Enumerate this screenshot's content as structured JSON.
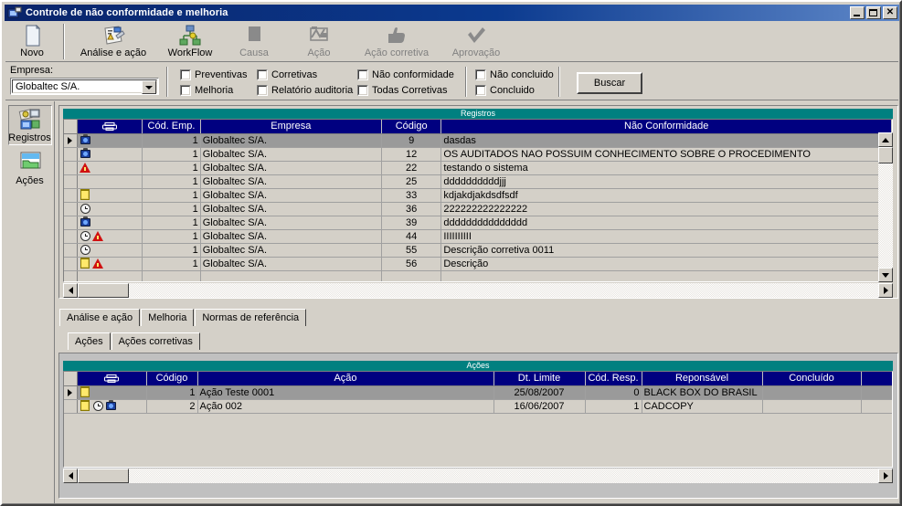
{
  "window": {
    "title": "Controle de não conformidade e melhoria",
    "icon": "app-icon",
    "minimize_label": "_",
    "maximize_label": "□",
    "close_label": "✕"
  },
  "toolbar": {
    "buttons": [
      {
        "label": "Novo",
        "icon": "new-document-icon",
        "enabled": true
      },
      {
        "label": "Análise e ação",
        "icon": "analysis-icon",
        "enabled": true
      },
      {
        "label": "WorkFlow",
        "icon": "workflow-icon",
        "enabled": true
      },
      {
        "label": "Causa",
        "icon": "cause-icon",
        "enabled": false
      },
      {
        "label": "Ação",
        "icon": "action-icon",
        "enabled": false
      },
      {
        "label": "Ação corretiva",
        "icon": "corrective-action-icon",
        "enabled": false
      },
      {
        "label": "Aprovação",
        "icon": "approval-check-icon",
        "enabled": false
      }
    ]
  },
  "filters": {
    "empresa_label": "Empresa:",
    "empresa_value": "Globaltec S/A.",
    "group1": [
      {
        "label": "Preventivas",
        "checked": false
      },
      {
        "label": "Melhoria",
        "checked": false
      }
    ],
    "group2": [
      {
        "label": "Corretivas",
        "checked": false
      },
      {
        "label": "Relatório auditoria",
        "checked": false
      }
    ],
    "group3": [
      {
        "label": "Não conformidade",
        "checked": false
      },
      {
        "label": "Todas Corretivas",
        "checked": false
      }
    ],
    "group4": [
      {
        "label": "Não concluido",
        "checked": false
      },
      {
        "label": "Concluido",
        "checked": false
      }
    ],
    "search_button": "Buscar"
  },
  "sidebar": {
    "items": [
      {
        "label": "Registros",
        "icon": "records-icon",
        "selected": true
      },
      {
        "label": "Ações",
        "icon": "folder-actions-icon",
        "selected": false
      }
    ]
  },
  "registros_grid": {
    "caption": "Registros",
    "columns": [
      "",
      "printer-icon",
      "Cód. Emp.",
      "Empresa",
      "Código",
      "Não Conformidade"
    ],
    "rows": [
      {
        "selected": true,
        "icons": [
          "cam"
        ],
        "cod_emp": "1",
        "empresa": "Globaltec S/A.",
        "codigo": "9",
        "nao_conformidade": "dasdas"
      },
      {
        "selected": false,
        "icons": [
          "cam"
        ],
        "cod_emp": "1",
        "empresa": "Globaltec S/A.",
        "codigo": "12",
        "nao_conformidade": "OS AUDITADOS NAO POSSUIM CONHECIMENTO SOBRE O PROCEDIMENTO"
      },
      {
        "selected": false,
        "icons": [
          "warn"
        ],
        "cod_emp": "1",
        "empresa": "Globaltec S/A.",
        "codigo": "22",
        "nao_conformidade": "testando o sistema"
      },
      {
        "selected": false,
        "icons": [],
        "cod_emp": "1",
        "empresa": "Globaltec S/A.",
        "codigo": "25",
        "nao_conformidade": "ddddddddddjjj"
      },
      {
        "selected": false,
        "icons": [
          "note"
        ],
        "cod_emp": "1",
        "empresa": "Globaltec S/A.",
        "codigo": "33",
        "nao_conformidade": "kdjakdjakdsdfsdf"
      },
      {
        "selected": false,
        "icons": [
          "clock"
        ],
        "cod_emp": "1",
        "empresa": "Globaltec S/A.",
        "codigo": "36",
        "nao_conformidade": "222222222222222"
      },
      {
        "selected": false,
        "icons": [
          "cam"
        ],
        "cod_emp": "1",
        "empresa": "Globaltec S/A.",
        "codigo": "39",
        "nao_conformidade": "ddddddddddddddd"
      },
      {
        "selected": false,
        "icons": [
          "clock",
          "warn"
        ],
        "cod_emp": "1",
        "empresa": "Globaltec S/A.",
        "codigo": "44",
        "nao_conformidade": "IIIIIIIIII"
      },
      {
        "selected": false,
        "icons": [
          "clock"
        ],
        "cod_emp": "1",
        "empresa": "Globaltec S/A.",
        "codigo": "55",
        "nao_conformidade": "Descrição corretiva 0011"
      },
      {
        "selected": false,
        "icons": [
          "note",
          "warn"
        ],
        "cod_emp": "1",
        "empresa": "Globaltec S/A.",
        "codigo": "56",
        "nao_conformidade": "Descrição"
      }
    ]
  },
  "tabs_outer": [
    {
      "label": "Análise e ação",
      "active": true
    },
    {
      "label": "Melhoria",
      "active": false
    },
    {
      "label": "Normas de referência",
      "active": false
    }
  ],
  "tabs_inner": [
    {
      "label": "Ações",
      "active": true
    },
    {
      "label": "Ações corretivas",
      "active": false
    }
  ],
  "acoes_grid": {
    "caption": "Ações",
    "columns": [
      "",
      "printer-icon",
      "Código",
      "Ação",
      "Dt. Limite",
      "Cód. Resp.",
      "Reponsável",
      "Concluído",
      ""
    ],
    "rows": [
      {
        "selected": true,
        "icons": [
          "note"
        ],
        "codigo": "1",
        "acao": "Ação Teste 0001",
        "dt_limite": "25/08/2007",
        "cod_resp": "0",
        "responsavel": "BLACK BOX DO BRASIL",
        "concluido": ""
      },
      {
        "selected": false,
        "icons": [
          "note",
          "clock",
          "cam"
        ],
        "codigo": "2",
        "acao": "Ação 002",
        "dt_limite": "16/06/2007",
        "cod_resp": "1",
        "responsavel": "CADCOPY",
        "concluido": ""
      }
    ]
  },
  "colors": {
    "window_face": "#d4d0c8",
    "title_start": "#0a246a",
    "title_end": "#5e87c8",
    "grid_header": "#000080",
    "grid_caption": "#008080",
    "selected_row": "#9a9a9a"
  }
}
